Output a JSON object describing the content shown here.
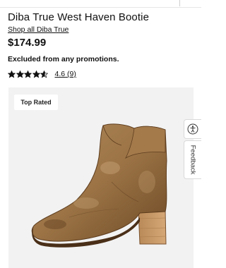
{
  "product": {
    "title": "Diba True West Haven Bootie",
    "shop_link": "Shop all Diba True",
    "price": "$174.99",
    "promo_note": "Excluded from any promotions.",
    "rating": {
      "stars": 4.6,
      "value_label": "4.6",
      "count_label": "(9)"
    }
  },
  "gallery": {
    "badge": "Top Rated",
    "image": "brown-distressed-leather-ankle-boot"
  },
  "side_tabs": {
    "accessibility_icon": "accessibility-icon",
    "feedback_label": "Feedback"
  },
  "colors": {
    "text": "#111111",
    "gallery_bg": "#f2f2f2",
    "star": "#111111"
  }
}
